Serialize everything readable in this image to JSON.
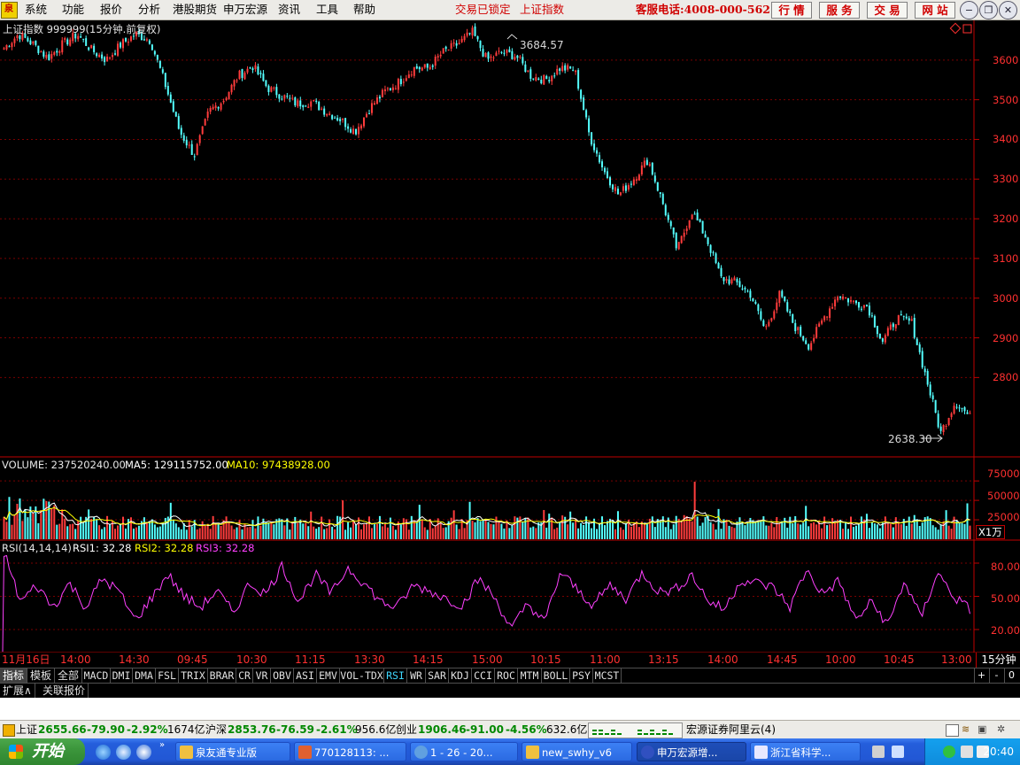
{
  "menu": {
    "items": [
      "系统",
      "功能",
      "报价",
      "分析",
      "港股期货",
      "申万宏源",
      "资讯",
      "工具",
      "帮助"
    ],
    "trade_lock": "交易已锁定",
    "current_index": "上证指数",
    "hotline": "客服电话:4008-000-562",
    "service_buttons": [
      "行 情",
      "服 务",
      "交 易",
      "网 站"
    ]
  },
  "price_chart": {
    "title": "上证指数 999999(15分钟.前复权)",
    "high_label": "3684.57",
    "low_label": "2638.30",
    "y_ticks": [
      "3600",
      "3500",
      "3400",
      "3300",
      "3200",
      "3100",
      "3000",
      "2900",
      "2800"
    ]
  },
  "volume_chart": {
    "label": "VOLUME: 237520240.00",
    "ma5": "MA5: 129115752.00",
    "ma10": "MA10: 97438928.00",
    "y_ticks": [
      "75000",
      "50000",
      "25000"
    ],
    "unit": "X1万"
  },
  "rsi_chart": {
    "label": "RSI(14,14,14)",
    "rsi1": "RSI1: 32.28",
    "rsi2": "RSI2: 32.28",
    "rsi3": "RSI3: 32.28",
    "y_ticks": [
      "80.00",
      "50.00",
      "20.00"
    ]
  },
  "time_axis": {
    "labels": [
      "11月16日",
      "14:00",
      "14:30",
      "09:45",
      "10:30",
      "11:15",
      "13:30",
      "14:15",
      "15:00",
      "10:15",
      "11:00",
      "13:15",
      "14:00",
      "14:45",
      "10:00",
      "10:45",
      "13:00"
    ],
    "period": "15分钟"
  },
  "indicator_tabs": [
    "指标",
    "模板",
    "全部",
    "MACD",
    "DMI",
    "DMA",
    "FSL",
    "TRIX",
    "BRAR",
    "CR",
    "VR",
    "OBV",
    "ASI",
    "EMV",
    "VOL-TDX",
    "RSI",
    "WR",
    "SAR",
    "KDJ",
    "CCI",
    "ROC",
    "MTM",
    "BOLL",
    "PSY",
    "MCST"
  ],
  "nav_buttons": [
    "+",
    "-",
    "0"
  ],
  "ext_tabs": [
    "扩展∧",
    "关联报价"
  ],
  "status_bar": {
    "sh_label": "上证",
    "sh_value": "2655.66",
    "sh_change": "-79.90",
    "sh_pct": "-2.92%",
    "sh_amount": "1674亿",
    "hs_label": "沪深",
    "hs_value": "2853.76",
    "hs_change": "-76.59",
    "hs_pct": "-2.61%",
    "hs_amount": "956.6亿",
    "cy_label": "创业",
    "cy_value": "1906.46",
    "cy_change": "-91.00",
    "cy_pct": "-4.56%",
    "cy_amount": "632.6亿",
    "server": "宏源证券阿里云(4)"
  },
  "taskbar": {
    "start": "开始",
    "tasks": [
      "泉友通专业版",
      "770128113: ...",
      "1 - 26 - 20...",
      "new_swhy_v6",
      "申万宏源增...",
      "浙江省科学..."
    ],
    "clock": "20:40"
  },
  "colors": {
    "up": "#ff3c3c",
    "down": "#54ffff",
    "axis": "#c00000",
    "ma5": "#ffffff",
    "ma10": "#ffff00",
    "rsi": "#ff40ff"
  },
  "chart_data": [
    {
      "type": "candlestick",
      "title": "上证指数 999999(15分钟.前复权)",
      "ylim": [
        2600,
        3700
      ],
      "high": 3684.57,
      "low": 2638.3,
      "close_path": [
        3630,
        3665,
        3640,
        3605,
        3640,
        3665,
        3625,
        3600,
        3640,
        3665,
        3650,
        3540,
        3420,
        3360,
        3470,
        3500,
        3560,
        3585,
        3530,
        3510,
        3490,
        3495,
        3470,
        3450,
        3420,
        3480,
        3520,
        3545,
        3580,
        3580,
        3620,
        3640,
        3670,
        3600,
        3620,
        3610,
        3560,
        3550,
        3580,
        3575,
        3410,
        3320,
        3260,
        3300,
        3350,
        3240,
        3120,
        3220,
        3150,
        3050,
        3040,
        3010,
        2920,
        3010,
        2930,
        2880,
        2950,
        3010,
        2990,
        2980,
        2890,
        2950,
        2940,
        2800,
        2660,
        2740,
        2700
      ]
    },
    {
      "type": "bar",
      "title": "VOLUME",
      "ylim": [
        0,
        90000
      ],
      "unit": "万",
      "series": [
        {
          "name": "MA5",
          "last": 129115752.0
        },
        {
          "name": "MA10",
          "last": 97438928.0
        }
      ]
    },
    {
      "type": "line",
      "title": "RSI(14,14,14)",
      "ylim": [
        0,
        100
      ],
      "rsi_path": [
        90,
        45,
        60,
        40,
        62,
        40,
        66,
        55,
        28,
        48,
        70,
        50,
        40,
        55,
        35,
        62,
        52,
        78,
        45,
        70,
        52,
        76,
        62,
        45,
        40,
        60,
        55,
        48,
        42,
        66,
        48,
        20,
        44,
        26,
        72,
        56,
        42,
        60,
        48,
        72,
        54,
        56,
        70,
        46,
        38,
        65,
        62,
        58,
        40,
        74,
        52,
        64,
        28,
        45,
        24,
        64,
        30,
        72,
        50,
        38
      ]
    }
  ]
}
